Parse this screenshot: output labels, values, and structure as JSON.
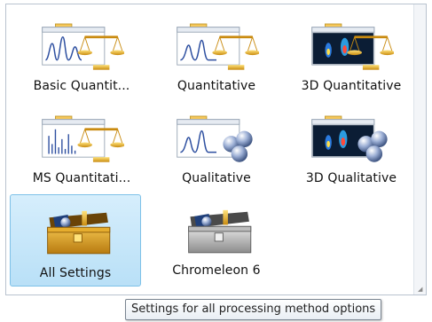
{
  "tiles": [
    {
      "label": "Basic Quantit...",
      "icon": "basic-quantitative-icon"
    },
    {
      "label": "Quantitative",
      "icon": "quantitative-icon"
    },
    {
      "label": "3D Quantitative",
      "icon": "3d-quantitative-icon"
    },
    {
      "label": "MS Quantitati...",
      "icon": "ms-quantitative-icon"
    },
    {
      "label": "Qualitative",
      "icon": "qualitative-icon"
    },
    {
      "label": "3D Qualitative",
      "icon": "3d-qualitative-icon"
    },
    {
      "label": "All Settings",
      "icon": "all-settings-icon"
    },
    {
      "label": "Chromeleon 6",
      "icon": "chromeleon-6-icon"
    }
  ],
  "selected_tile": "All Settings",
  "tooltip": "Settings for all processing method options",
  "colors": {
    "selection_bg": "#c7e7fa",
    "folder_tab": "#f6c85a",
    "scale_gold": "#d9a21e",
    "sphere_blue": "#7d94bf",
    "dark_plot": "#0b1d35"
  }
}
